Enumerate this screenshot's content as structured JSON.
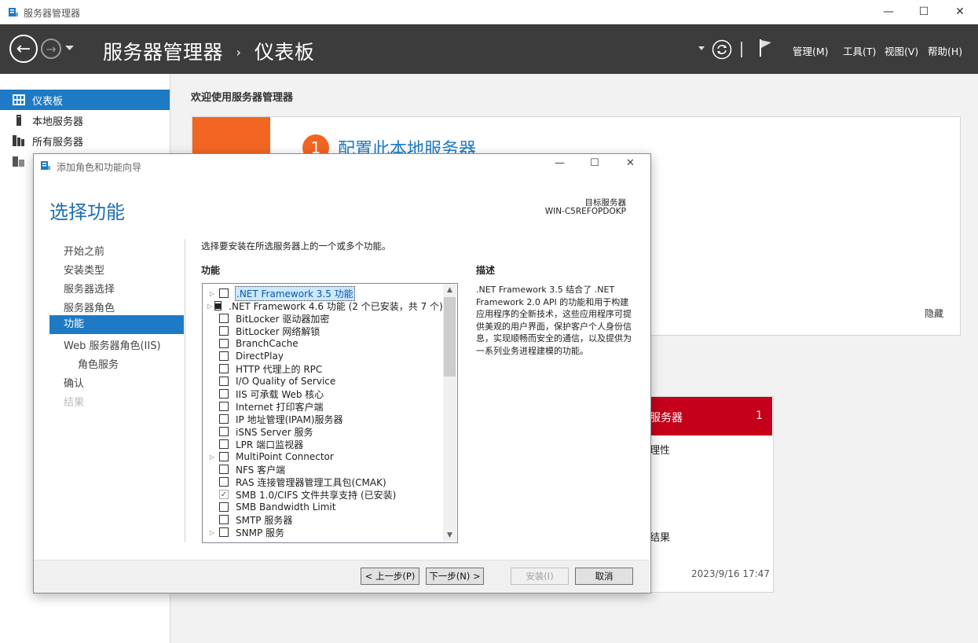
{
  "window": {
    "title": "服务器管理器",
    "controls": {
      "minimize": "—",
      "maximize": "☐",
      "close": "✕"
    }
  },
  "header": {
    "back_glyph": "←",
    "forward_glyph": "→",
    "breadcrumb_root": "服务器管理器",
    "breadcrumb_sep": "›",
    "breadcrumb_page": "仪表板",
    "menus": [
      "管理(M)",
      "工具(T)",
      "视图(V)",
      "帮助(H)"
    ]
  },
  "sidebar": {
    "items": [
      {
        "label": "仪表板",
        "icon": "dashboard-icon",
        "selected": true
      },
      {
        "label": "本地服务器",
        "icon": "server-icon"
      },
      {
        "label": "所有服务器",
        "icon": "servers-icon"
      },
      {
        "label": "",
        "icon": "file-services-icon"
      }
    ]
  },
  "dashboard": {
    "welcome": "欢迎使用服务器管理器",
    "quick_start": {
      "step_number": "1",
      "step_label": "配置此本地服务器",
      "hide": "隐藏"
    },
    "tile": {
      "title": "服务器",
      "count": "1",
      "line1": "理性",
      "line2": "结果",
      "timestamp": "2023/9/16 17:47"
    }
  },
  "wizard": {
    "title": "添加角色和功能向导",
    "heading": "选择功能",
    "target_label": "目标服务器",
    "target_value": "WIN-C5REFOPDOKP",
    "steps": [
      {
        "label": "开始之前"
      },
      {
        "label": "安装类型"
      },
      {
        "label": "服务器选择"
      },
      {
        "label": "服务器角色"
      },
      {
        "label": "功能",
        "selected": true
      },
      {
        "label": "Web 服务器角色(IIS)"
      },
      {
        "label": "角色服务",
        "indent": true
      },
      {
        "label": "确认"
      },
      {
        "label": "结果",
        "disabled": true
      }
    ],
    "instruction": "选择要安装在所选服务器上的一个或多个功能。",
    "features_header": "功能",
    "description_header": "描述",
    "description": ".NET Framework 3.5 结合了 .NET Framework 2.0 API 的功能和用于构建应用程序的全新技术，这些应用程序可提供美观的用户界面，保护客户个人身份信息，实现顺畅而安全的通信，以及提供为一系列业务进程建模的功能。",
    "features": [
      {
        "label": ".NET Framework 3.5 功能",
        "expand": true,
        "state": "unchecked",
        "highlighted": true
      },
      {
        "label": ".NET Framework 4.6 功能 (2 个已安装，共 7 个)",
        "expand": true,
        "state": "partial"
      },
      {
        "label": "BitLocker 驱动器加密",
        "state": "unchecked"
      },
      {
        "label": "BitLocker 网络解锁",
        "state": "unchecked"
      },
      {
        "label": "BranchCache",
        "state": "unchecked"
      },
      {
        "label": "DirectPlay",
        "state": "unchecked"
      },
      {
        "label": "HTTP 代理上的 RPC",
        "state": "unchecked"
      },
      {
        "label": "I/O Quality of Service",
        "state": "unchecked"
      },
      {
        "label": "IIS 可承载 Web 核心",
        "state": "unchecked"
      },
      {
        "label": "Internet 打印客户端",
        "state": "unchecked"
      },
      {
        "label": "IP 地址管理(IPAM)服务器",
        "state": "unchecked"
      },
      {
        "label": "iSNS Server 服务",
        "state": "unchecked"
      },
      {
        "label": "LPR 端口监视器",
        "state": "unchecked"
      },
      {
        "label": "MultiPoint Connector",
        "expand": true,
        "state": "unchecked"
      },
      {
        "label": "NFS 客户端",
        "state": "unchecked"
      },
      {
        "label": "RAS 连接管理器管理工具包(CMAK)",
        "state": "unchecked"
      },
      {
        "label": "SMB 1.0/CIFS 文件共享支持 (已安装)",
        "state": "installed"
      },
      {
        "label": "SMB Bandwidth Limit",
        "state": "unchecked"
      },
      {
        "label": "SMTP 服务器",
        "state": "unchecked"
      },
      {
        "label": "SNMP 服务",
        "expand": true,
        "state": "unchecked"
      }
    ],
    "buttons": {
      "prev": "< 上一步(P)",
      "next": "下一步(N) >",
      "install": "安装(I)",
      "cancel": "取消"
    }
  },
  "colors": {
    "header_bg": "#3c3c3c",
    "selection_blue": "#1e7ac4",
    "quick_start_orange": "#f26522",
    "tile_red": "#c4001a"
  }
}
